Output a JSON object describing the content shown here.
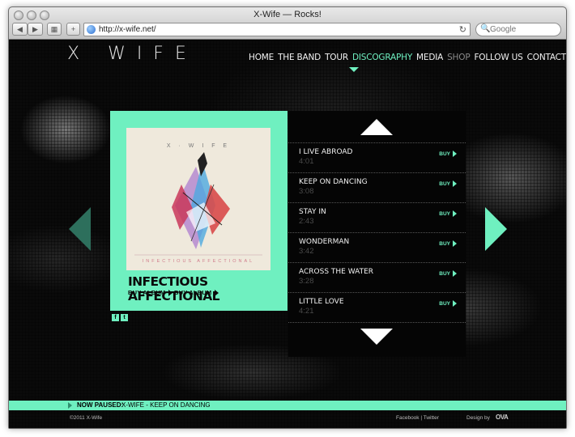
{
  "browser": {
    "window_title": "X-Wife — Rocks!",
    "back_label": "◀",
    "forward_label": "▶",
    "grid_label": "▦",
    "add_label": "+",
    "url": "http://x-wife.net/",
    "reload_label": "↻",
    "search_placeholder": "Google",
    "search_icon": "🔍"
  },
  "site": {
    "logo": "X WIFE",
    "nav": [
      {
        "label": "HOME"
      },
      {
        "label": "THE BAND"
      },
      {
        "label": "TOUR"
      },
      {
        "label": "DISCOGRAPHY"
      },
      {
        "label": "MEDIA"
      },
      {
        "label": "SHOP"
      },
      {
        "label": "FOLLOW US"
      },
      {
        "label": "CONTACT"
      }
    ],
    "accent_color": "#6ff0c0"
  },
  "album": {
    "cover_band": "X · W I F E",
    "cover_title": "INFECTIOUS AFFECTIONAL",
    "title": "INFECTIOUS AFFECTIONAL",
    "buy_1": "BUY ALBUM",
    "buy_2": "BUY ALBUM",
    "share_f": "f",
    "share_t": "t"
  },
  "tracks": [
    {
      "title": "I LIVE ABROAD",
      "time": "4:01",
      "buy": "BUY"
    },
    {
      "title": "KEEP ON DANCING",
      "time": "3:08",
      "buy": "BUY"
    },
    {
      "title": "STAY IN",
      "time": "2:43",
      "buy": "BUY"
    },
    {
      "title": "WONDERMAN",
      "time": "3:42",
      "buy": "BUY"
    },
    {
      "title": "ACROSS THE WATER",
      "time": "3:28",
      "buy": "BUY"
    },
    {
      "title": "LITTLE LOVE",
      "time": "4:21",
      "buy": "BUY"
    }
  ],
  "player": {
    "status": "NOW PAUSED:",
    "track": "X-WIFE - KEEP ON DANCING"
  },
  "footer": {
    "copyright": "©2011 X-Wife",
    "social": "Facebook | Twitter",
    "design": "Design by",
    "designer": "OVA"
  }
}
